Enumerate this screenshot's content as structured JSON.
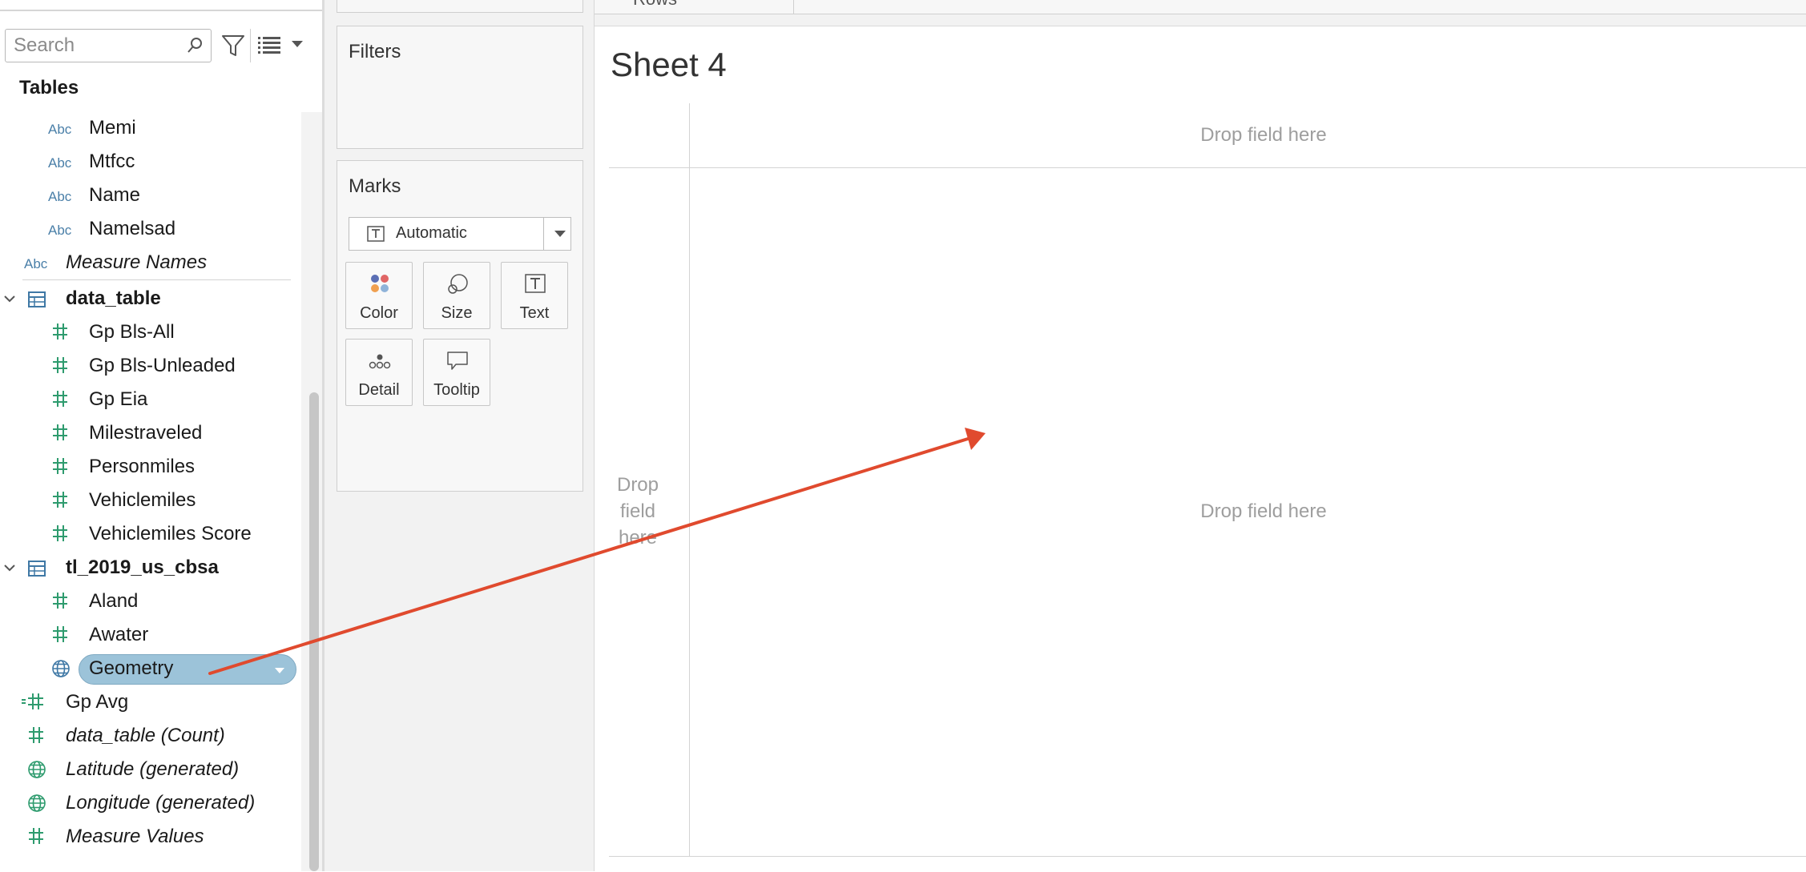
{
  "search": {
    "placeholder": "Search"
  },
  "data_pane": {
    "tables_heading": "Tables",
    "dimension_tag": "Abc",
    "fields_top": [
      {
        "label": "Memi",
        "kind": "dimension"
      },
      {
        "label": "Mtfcc",
        "kind": "dimension"
      },
      {
        "label": "Name",
        "kind": "dimension"
      },
      {
        "label": "Namelsad",
        "kind": "dimension"
      },
      {
        "label": "Measure Names",
        "kind": "dimension"
      }
    ],
    "tables": [
      {
        "name": "data_table",
        "fields": [
          "Gp Bls-All",
          "Gp Bls-Unleaded",
          "Gp Eia",
          "Milestraveled",
          "Personmiles",
          "Vehiclemiles",
          "Vehiclemiles Score"
        ]
      },
      {
        "name": "tl_2019_us_cbsa",
        "fields": [
          "Aland",
          "Awater",
          "Geometry"
        ]
      }
    ],
    "selected_field": "Geometry",
    "measures_bottom": [
      {
        "label": "Gp Avg",
        "icon": "calculated-measure-icon"
      },
      {
        "label": "data_table (Count)",
        "icon": "hash-icon"
      },
      {
        "label": "Latitude (generated)",
        "icon": "globe-icon"
      },
      {
        "label": "Longitude (generated)",
        "icon": "globe-icon"
      },
      {
        "label": "Measure Values",
        "icon": "hash-icon"
      }
    ]
  },
  "shelves": {
    "rows_label": "Rows",
    "filters_title": "Filters",
    "marks_title": "Marks",
    "mark_type": "Automatic",
    "mark_buttons": [
      {
        "label": "Color",
        "icon": "color-icon"
      },
      {
        "label": "Size",
        "icon": "size-icon"
      },
      {
        "label": "Text",
        "icon": "text-icon"
      },
      {
        "label": "Detail",
        "icon": "detail-icon"
      },
      {
        "label": "Tooltip",
        "icon": "tooltip-icon"
      }
    ]
  },
  "sheet": {
    "title": "Sheet 4",
    "drop_top": "Drop field here",
    "drop_center": "Drop field here",
    "drop_left": "Drop field here"
  },
  "colors": {
    "selected_pill": "#9cc3d9",
    "dimension_icon": "#4a7fa8",
    "measure_icon": "#2e9b6e",
    "annotation_arrow": "#e04a2e"
  }
}
